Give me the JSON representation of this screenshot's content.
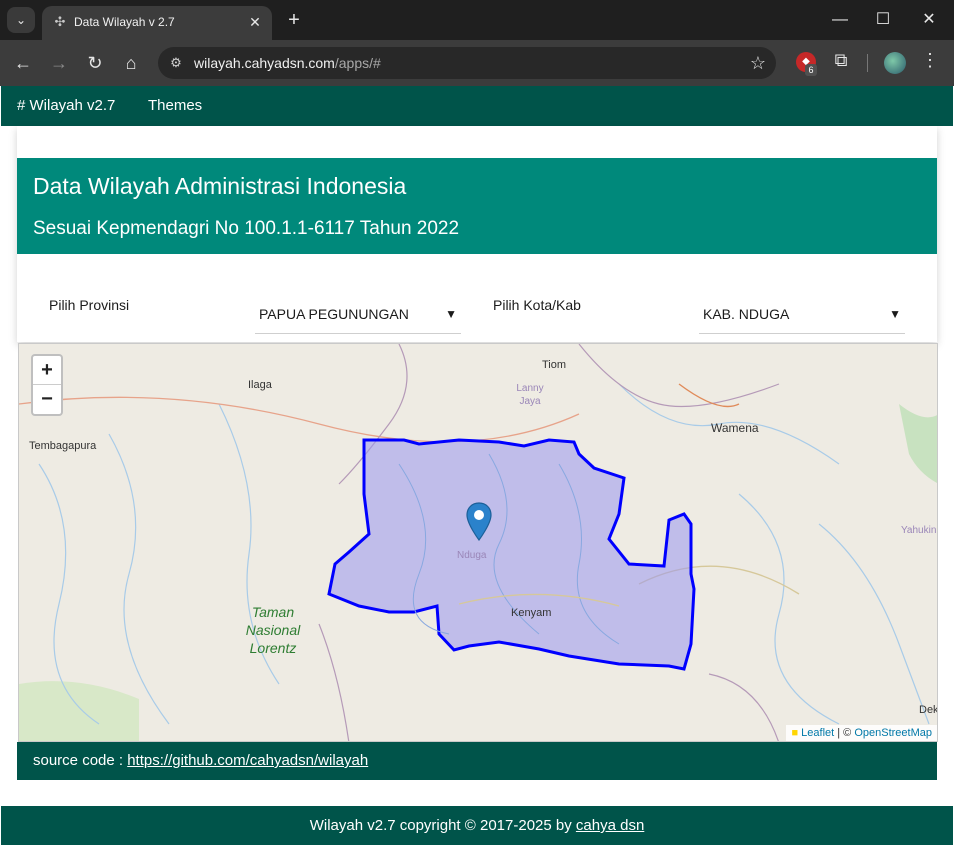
{
  "browser": {
    "tab_title": "Data Wilayah v 2.7",
    "url_domain": "wilayah.cahyadsn.com",
    "url_path": "/apps/#",
    "extension_badge_count": "6"
  },
  "navbar": {
    "brand": "# Wilayah v2.7",
    "themes": "Themes"
  },
  "header": {
    "title": "Data Wilayah Administrasi Indonesia",
    "subtitle": "Sesuai Kepmendagri No 100.1.1-6117 Tahun 2022"
  },
  "filters": {
    "province_label": "Pilih Provinsi",
    "province_value": "PAPUA PEGUNUNGAN",
    "city_label": "Pilih Kota/Kab",
    "city_value": "KAB. NDUGA"
  },
  "map": {
    "zoom_in": "+",
    "zoom_out": "−",
    "places": {
      "ilaga": "Ilaga",
      "tiom": "Tiom",
      "lanny_jaya": "Lanny Jaya",
      "wamena": "Wamena",
      "tembagapura": "Tembagapura",
      "nduga": "Nduga",
      "kenyam": "Kenyam",
      "yahukimo": "Yahukin",
      "dek": "Dek"
    },
    "park": "Taman Nasional Lorentz",
    "attribution_leaflet": "Leaflet",
    "attribution_sep": " | © ",
    "attribution_osm": "OpenStreetMap",
    "region_color": "#0000ff",
    "region_fill": "#9b98f0"
  },
  "source": {
    "label": "source code : ",
    "link": "https://github.com/cahyadsn/wilayah"
  },
  "footer": {
    "text": "Wilayah v2.7 copyright © 2017-2025 by ",
    "link": "cahya dsn"
  }
}
